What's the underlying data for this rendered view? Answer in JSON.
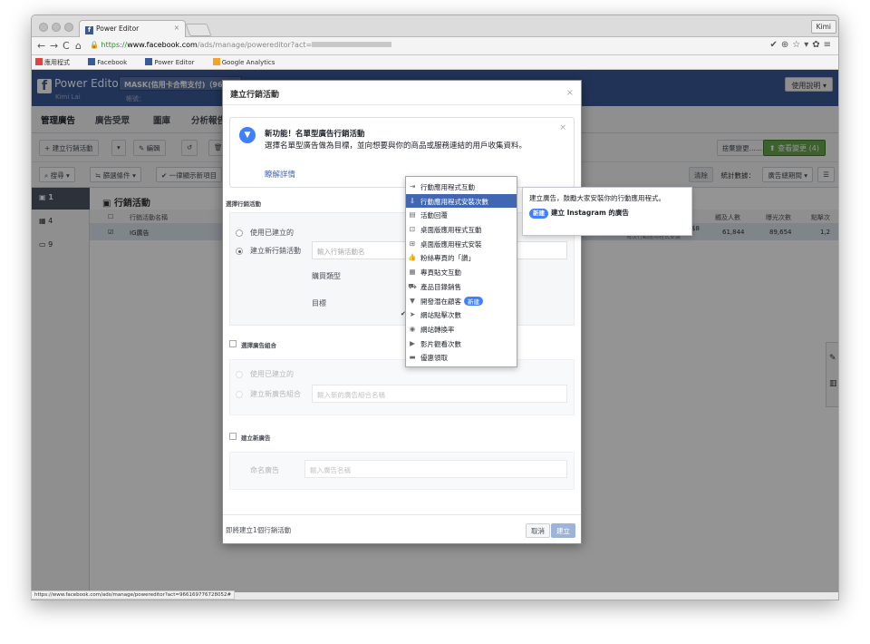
{
  "browser": {
    "tab_title": "Power Editor",
    "tab_close": "×",
    "user": "Kimi",
    "url_scheme": "https://",
    "url_domain": "www.facebook.com",
    "url_path": "/ads/manage/powereditor?act=",
    "bookmarks": [
      "應用程式",
      "Facebook",
      "Power Editor",
      "Google Analytics"
    ],
    "status_url": "https://www.facebook.com/ads/manage/powereditor?act=966169776728052#"
  },
  "app": {
    "logo": "Power Editor",
    "user_name": "Kimi Lai",
    "account": "MASK(信用卡合幣支付)（96... ▾",
    "account_sub": "帳號：",
    "help": "使用說明",
    "tabs": [
      "管理廣告",
      "廣告受眾",
      "圖庫",
      "分析報告"
    ],
    "toolbar": {
      "create_campaign": "+ 建立行銷活動",
      "edit": "✎ 編輯",
      "discard": "捨棄變更......",
      "review": "⬆ 查看變更 (4)"
    },
    "filters": {
      "search": "搜尋 ▾",
      "filter": "篩選條件 ▾",
      "show_new": "✔ 一律顯示新項目",
      "clear": "清除",
      "stats": "統計數據：",
      "period": "廣告總期間 ▾"
    },
    "left_rows": [
      "1",
      "4",
      "9"
    ],
    "table": {
      "title": "行銷活動",
      "headers": [
        "行銷活動名稱",
        "觸及人數",
        "曝光次數",
        "點擊次"
      ],
      "row": {
        "name": "IG廣告",
        "result_label": "每次行動應用程式安裝",
        "value_prefix": "$8",
        "reach": "61,844",
        "impressions": "89,654",
        "clicks": "1,2"
      }
    }
  },
  "modal": {
    "title": "建立行銷活動",
    "close": "×",
    "notice": {
      "icon": "▼",
      "title": "新功能！名單型廣告行銷活動",
      "body": "選擇名單型廣告做為目標，並向想要與你的商品或服務連結的用戶收集資料。",
      "link": "瞭解詳情",
      "close": "×"
    },
    "campaign_section": "選擇行銷活動",
    "use_existing": "使用已建立的",
    "create_new_campaign": "建立新行銷活動",
    "campaign_placeholder": "輸入行銷活動名",
    "buying_type": "購買類型",
    "objective": "目標",
    "adset_section": "選擇廣告組合",
    "adset_use_existing": "使用已建立的",
    "adset_create_new": "建立新廣告組合",
    "adset_placeholder": "輸入新的廣告組合名稱",
    "ad_section": "建立新廣告",
    "ad_name_label": "命名廣告",
    "ad_placeholder": "輸入廣告名稱",
    "footer_text": "即將建立1個行銷活動",
    "cancel": "取消",
    "create": "建立"
  },
  "objective_dropdown": {
    "items": [
      {
        "label": "行動應用程式互動",
        "icon": "app-engagement-icon",
        "glyph": "⇥"
      },
      {
        "label": "行動應用程式安裝次數",
        "icon": "app-install-icon",
        "glyph": "⇩",
        "selected": true
      },
      {
        "label": "活動回覆",
        "icon": "event-icon",
        "glyph": "▤"
      },
      {
        "label": "桌面版應用程式互動",
        "icon": "desktop-app-engagement-icon",
        "glyph": "⊡"
      },
      {
        "label": "桌面版應用程式安裝",
        "icon": "desktop-app-install-icon",
        "glyph": "⊞"
      },
      {
        "label": "粉絲專頁的「讚」",
        "icon": "like-icon",
        "glyph": "👍"
      },
      {
        "label": "專頁貼文互動",
        "icon": "post-engagement-icon",
        "glyph": "▦"
      },
      {
        "label": "產品目錄銷售",
        "icon": "cart-icon",
        "glyph": "⛟"
      },
      {
        "label": "開發潛在顧客",
        "icon": "filter-icon",
        "glyph": "▼",
        "badge": "新建"
      },
      {
        "label": "網站點擊次數",
        "icon": "cursor-icon",
        "glyph": "➤",
        "checked": true
      },
      {
        "label": "網站轉換率",
        "icon": "globe-icon",
        "glyph": "◉"
      },
      {
        "label": "影片觀看次數",
        "icon": "video-icon",
        "glyph": "▶"
      },
      {
        "label": "優惠領取",
        "icon": "offer-icon",
        "glyph": "▬"
      }
    ]
  },
  "tooltip": {
    "text": "建立廣告，鼓勵大家安裝你的行動應用程式。",
    "badge": "新建",
    "line2": "建立 Instagram 的廣告"
  }
}
